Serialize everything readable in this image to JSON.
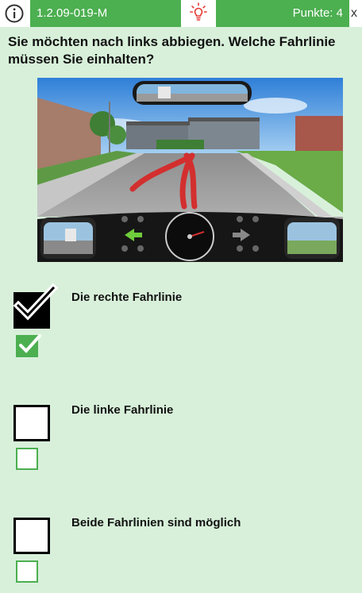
{
  "header": {
    "question_id": "1.2.09-019-M",
    "points_label": "Punkte: 4",
    "close_glyph": "x"
  },
  "question": {
    "text": "Sie möchten nach links abbiegen. Welche Fahrlinie müssen Sie einhalten?"
  },
  "answers": [
    {
      "label": "Die rechte Fahrlinie",
      "selected": true,
      "correct": true
    },
    {
      "label": "Die linke Fahrlinie",
      "selected": false,
      "correct": false
    },
    {
      "label": "Beide Fahrlinien sind möglich",
      "selected": false,
      "correct": false
    }
  ],
  "colors": {
    "accent_green": "#4caf50",
    "background": "#d8f0da",
    "hint_red": "#e53935"
  }
}
